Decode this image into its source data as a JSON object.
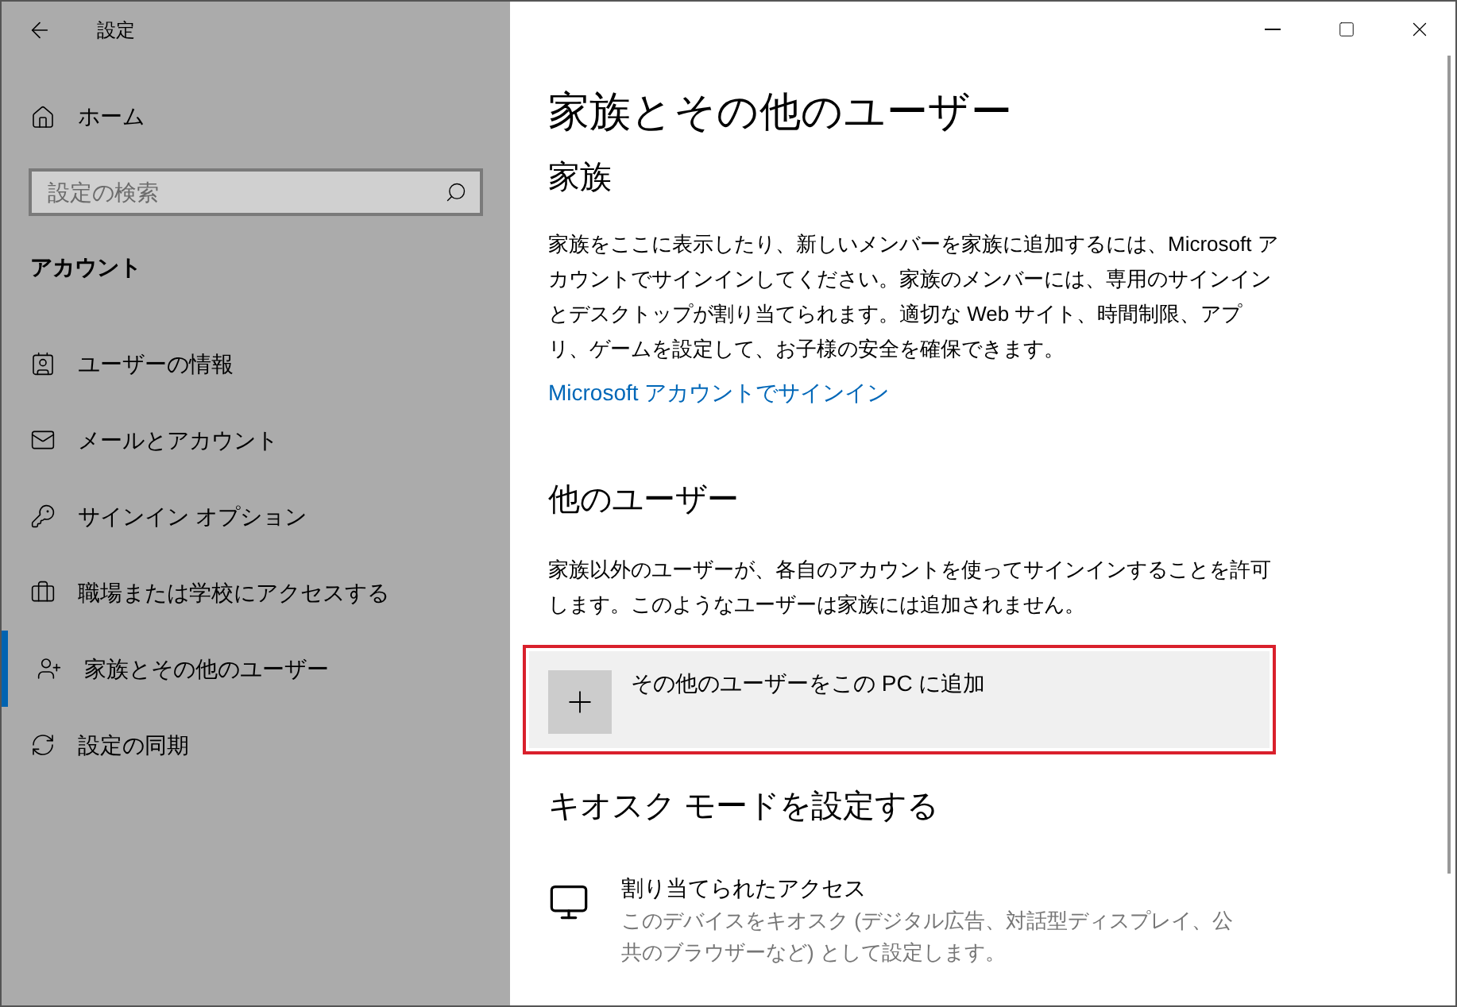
{
  "window": {
    "title": "設定"
  },
  "sidebar": {
    "home": "ホーム",
    "search": {
      "placeholder": "設定の検索"
    },
    "section": "アカウント",
    "items": [
      {
        "label": "ユーザーの情報",
        "selected": false
      },
      {
        "label": "メールとアカウント",
        "selected": false
      },
      {
        "label": "サインイン オプション",
        "selected": false
      },
      {
        "label": "職場または学校にアクセスする",
        "selected": false
      },
      {
        "label": "家族とその他のユーザー",
        "selected": true
      },
      {
        "label": "設定の同期",
        "selected": false
      }
    ]
  },
  "page": {
    "title": "家族とその他のユーザー",
    "family": {
      "heading": "家族",
      "text": "家族をここに表示したり、新しいメンバーを家族に追加するには、Microsoft アカウントでサインインしてください。家族のメンバーには、専用のサインインとデスクトップが割り当てられます。適切な Web サイト、時間制限、アプリ、ゲームを設定して、お子様の安全を確保できます。",
      "link": "Microsoft アカウントでサインイン"
    },
    "others": {
      "heading": "他のユーザー",
      "text": "家族以外のユーザーが、各自のアカウントを使ってサインインすることを許可します。このようなユーザーは家族には追加されません。",
      "add_button": "その他のユーザーをこの PC に追加"
    },
    "kiosk": {
      "heading": "キオスク モードを設定する",
      "item_title": "割り当てられたアクセス",
      "item_text": "このデバイスをキオスク (デジタル広告、対話型ディスプレイ、公共のブラウザーなど) として設定します。"
    }
  }
}
